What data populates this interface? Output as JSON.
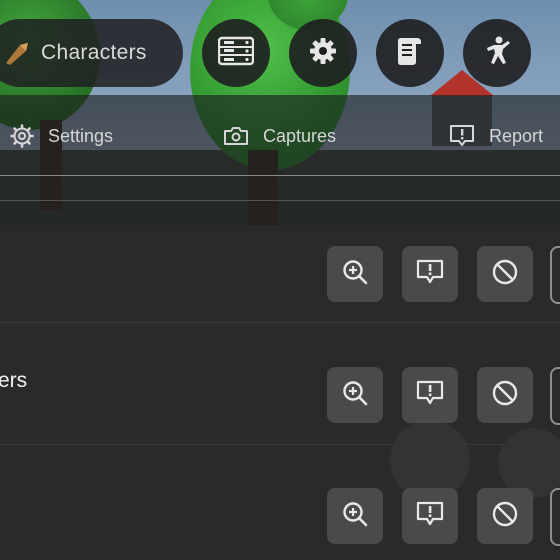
{
  "topbar": {
    "characters_label": "Characters",
    "icons": [
      "character-icon",
      "server-icon",
      "gear-icon",
      "scroll-icon",
      "emote-icon"
    ]
  },
  "tabs": [
    {
      "label": "Settings",
      "icon": "gear-icon"
    },
    {
      "label": "Captures",
      "icon": "camera-icon"
    },
    {
      "label": "Report",
      "icon": "report-icon"
    }
  ],
  "players": [
    {
      "name": "",
      "actions": [
        "zoom-in-icon",
        "report-icon",
        "block-icon"
      ]
    },
    {
      "name": "ers",
      "actions": [
        "zoom-in-icon",
        "report-icon",
        "block-icon"
      ]
    },
    {
      "name": "",
      "actions": [
        "zoom-in-icon",
        "report-icon",
        "block-icon"
      ]
    }
  ],
  "colors": {
    "panel": "#2a2a2c",
    "button": "#4a4a4d",
    "pill": "#202022"
  }
}
